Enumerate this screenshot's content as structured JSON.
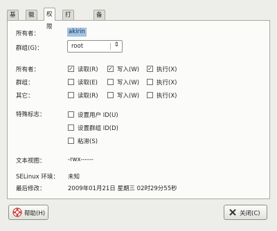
{
  "tabs": [
    "基本",
    "徽标",
    "权限",
    "打开方式",
    "备注"
  ],
  "owner": {
    "label": "所有者：",
    "value": "akirin"
  },
  "group": {
    "label": "群组(G)：",
    "value": "root"
  },
  "permissions": {
    "rows": [
      {
        "label": "所有者：",
        "read": {
          "label": "读取(R)",
          "checked": true
        },
        "write": {
          "label": "写入(W)",
          "checked": true
        },
        "exec": {
          "label": "执行(X)",
          "checked": true
        }
      },
      {
        "label": "群组：",
        "read": {
          "label": "读取(E)",
          "checked": false
        },
        "write": {
          "label": "写入(W)",
          "checked": false
        },
        "exec": {
          "label": "执行(X)",
          "checked": false
        }
      },
      {
        "label": "其它：",
        "read": {
          "label": "读取(R)",
          "checked": false
        },
        "write": {
          "label": "写入(W)",
          "checked": false
        },
        "exec": {
          "label": "执行(X)",
          "checked": false
        }
      }
    ]
  },
  "special": {
    "label": "特殊标志：",
    "items": [
      {
        "label": "设置用户 ID(U)",
        "checked": false
      },
      {
        "label": "设置群组 ID(D)",
        "checked": false
      },
      {
        "label": "粘滞(S)",
        "checked": false
      }
    ]
  },
  "text_view": {
    "label": "文本视图：",
    "value": "-rwx------"
  },
  "selinux": {
    "label": "SELinux 环境：",
    "value": "未知"
  },
  "last_changed": {
    "label": "最后修改：",
    "value": "2009年01月21日 星期三 02时29分55秒"
  },
  "buttons": {
    "help": "帮助(H)",
    "close": "关闭(C)"
  },
  "colors": {
    "selection": "#a4c3e4",
    "help_icon": "#c8413b"
  },
  "icons": {
    "help": "lifebuoy-icon",
    "close": "close-x-icon",
    "combo_arrow": "up-down-arrows-icon",
    "check": "checkmark"
  }
}
